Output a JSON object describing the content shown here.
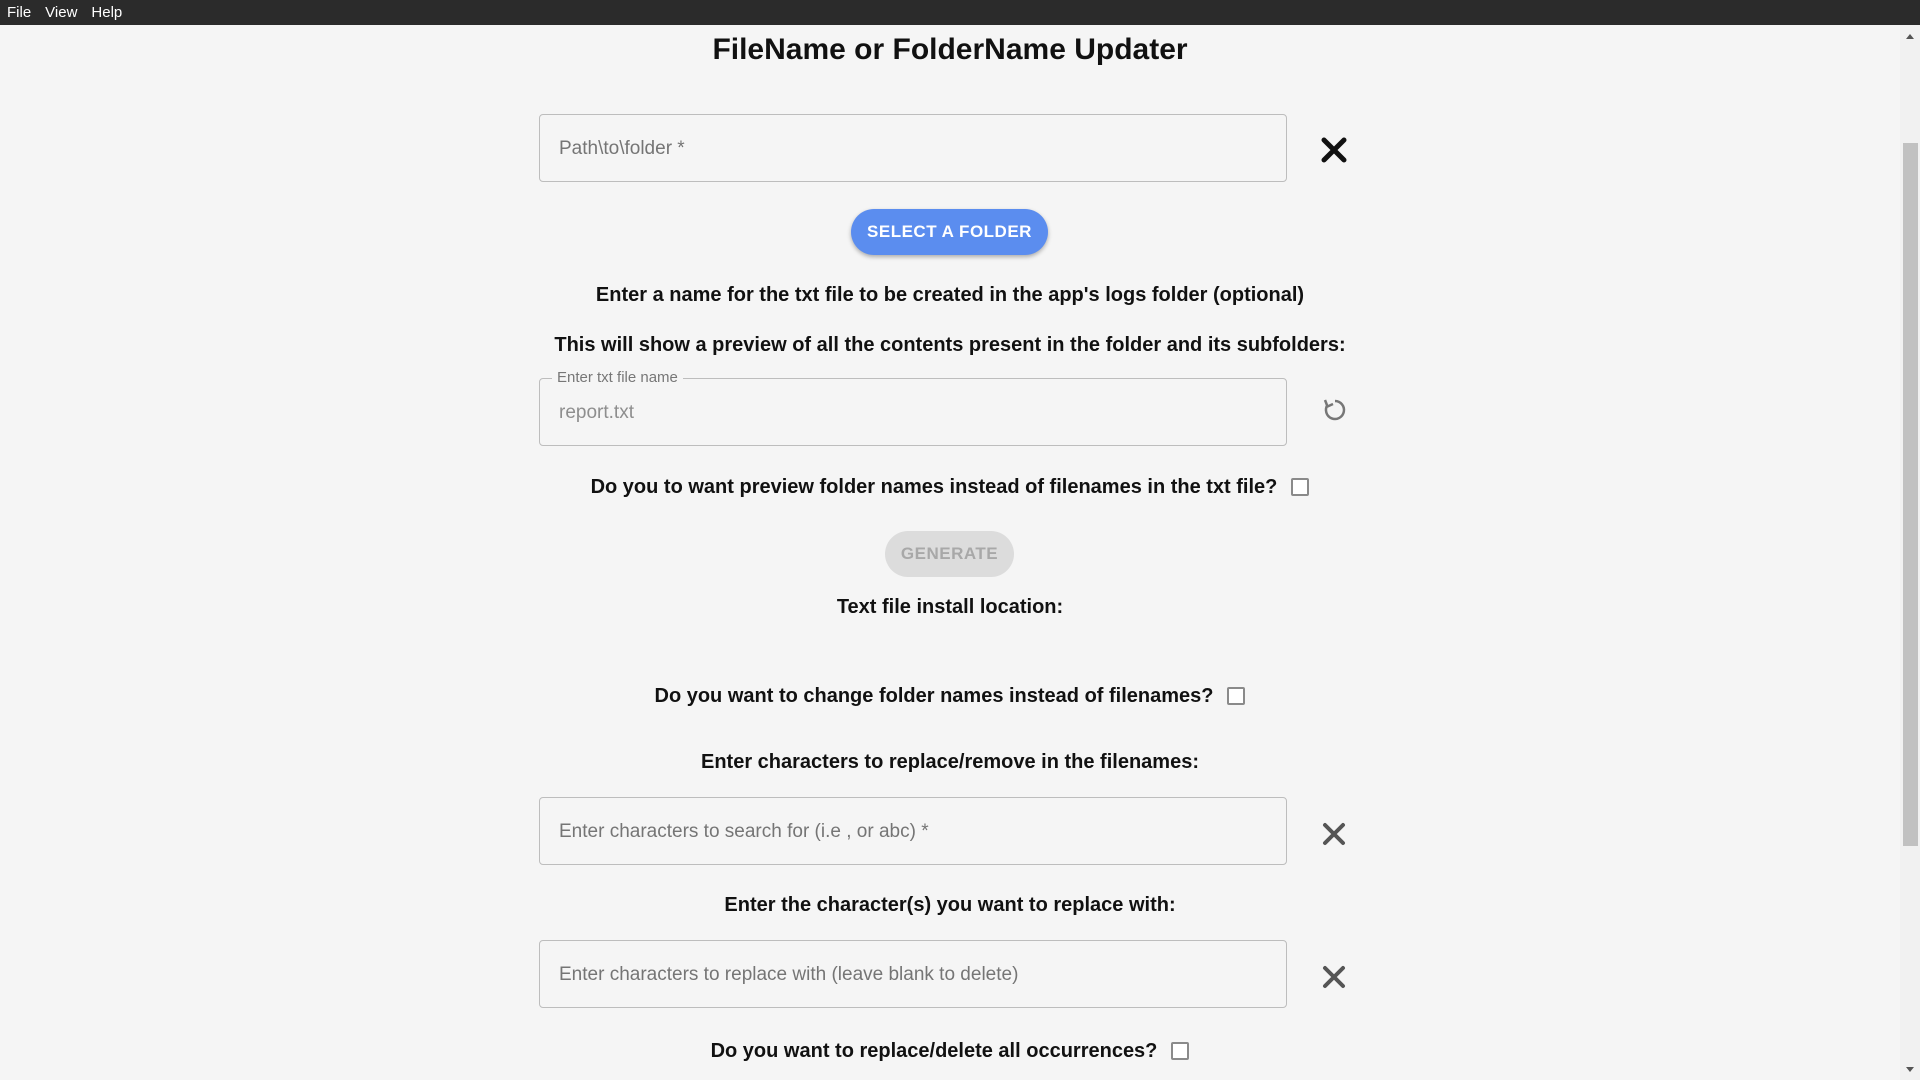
{
  "menu": [
    "File",
    "View",
    "Help"
  ],
  "title": "FileName or FolderName Updater",
  "folder_input": {
    "placeholder": "Path\\to\\folder *",
    "clear_icon": "close-icon"
  },
  "select_folder_button": "Select a folder",
  "txt_prompt": "Enter a name for the txt file to be created in the app's logs folder (optional)",
  "preview_prompt": "This will show a preview of all the contents present in the folder and its subfolders:",
  "txt_name_input": {
    "label": "Enter txt file name",
    "value": "report.txt",
    "reset_icon": "refresh-icon"
  },
  "preview_folders_question": "Do you to want preview folder names instead of filenames in the txt file?",
  "generate_button": "Generate",
  "install_location_label": "Text file install location:",
  "change_folders_question": "Do you want to change folder names instead of filenames?",
  "replace_prompt": "Enter characters to replace/remove in the filenames:",
  "search_input": {
    "placeholder": "Enter characters to search for (i.e , or abc) *",
    "clear_icon": "close-icon"
  },
  "replace_with_prompt": "Enter the character(s) you want to replace with:",
  "replace_input": {
    "placeholder": "Enter characters to replace with (leave blank to delete)",
    "clear_icon": "close-icon"
  },
  "all_occurrences_question": "Do you want to replace/delete all occurrences?",
  "colors": {
    "primary": "#5b8def",
    "menubar": "#2b2b2b",
    "background": "#f5f5f5"
  }
}
